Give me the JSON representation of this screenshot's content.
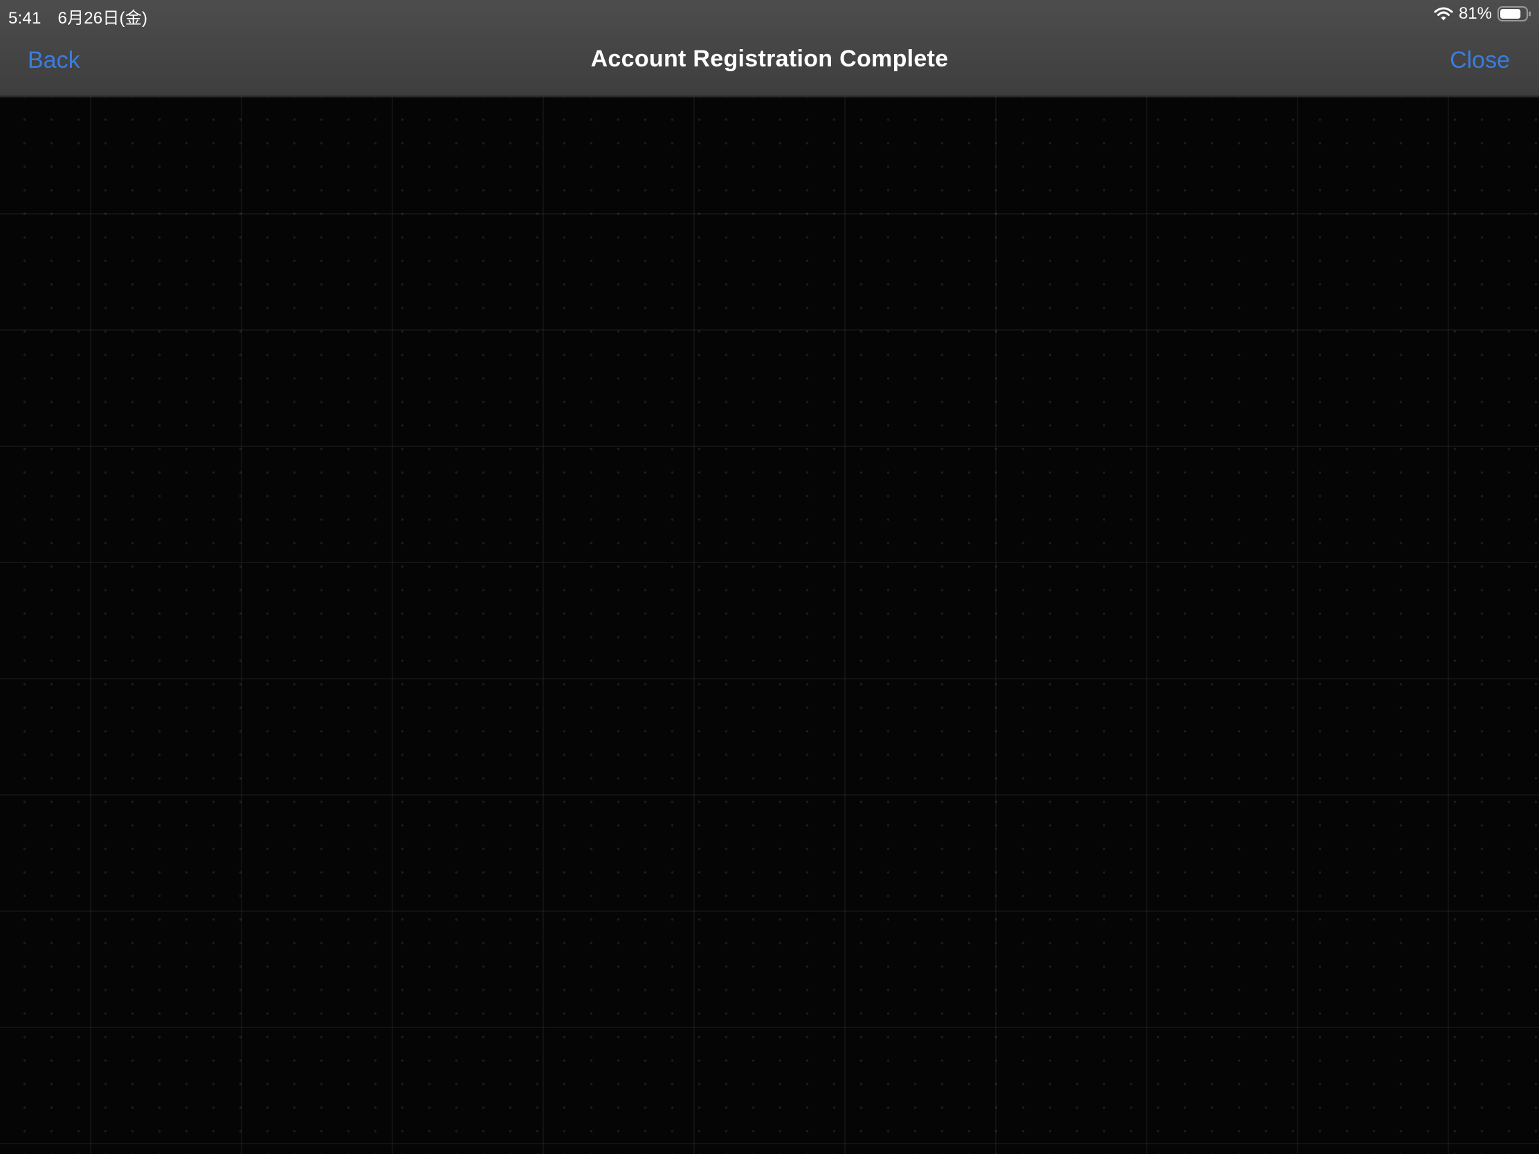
{
  "status_bar": {
    "time": "5:41",
    "date": "6月26日(金)",
    "battery_percent": "81%",
    "battery_level": 0.81,
    "wifi_icon": "wifi-icon",
    "battery_icon": "battery-icon"
  },
  "nav_bar": {
    "back_label": "Back",
    "title": "Account Registration Complete",
    "close_label": "Close",
    "accent_color": "#3a7ddd"
  },
  "content": {
    "background_color": "#050505"
  }
}
